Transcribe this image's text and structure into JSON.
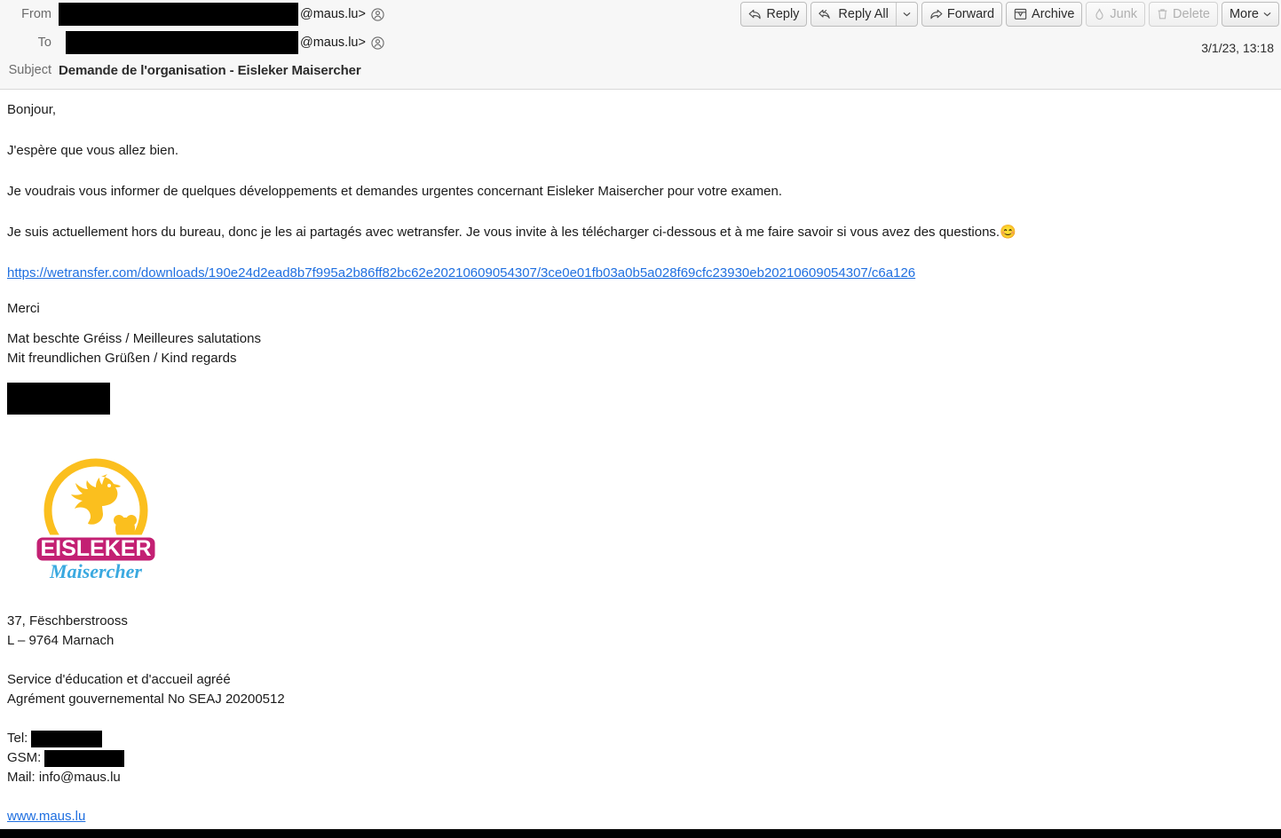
{
  "header": {
    "from_label": "From",
    "to_label": "To",
    "subject_label": "Subject",
    "from_domain": "@maus.lu>",
    "to_domain": "@maus.lu>",
    "subject": "Demande de l'organisation - Eisleker Maisercher",
    "date": "3/1/23, 13:18"
  },
  "toolbar": {
    "reply": "Reply",
    "reply_all": "Reply All",
    "forward": "Forward",
    "archive": "Archive",
    "junk": "Junk",
    "delete": "Delete",
    "more": "More",
    "icons": {
      "reply": "reply-arrow-icon",
      "reply_all": "reply-all-arrow-icon",
      "forward": "forward-arrow-icon",
      "archive": "archive-box-icon",
      "junk": "flame-icon",
      "delete": "trash-icon",
      "dropdown": "chevron-down-icon"
    }
  },
  "body": {
    "greeting": "Bonjour,",
    "line_hope": "J'espère que vous allez bien.",
    "line_inform": "Je voudrais vous informer de quelques développements et demandes urgentes concernant Eisleker Maisercher pour votre examen.",
    "line_wetransfer": "Je suis actuellement hors du bureau, donc je les ai partagés avec wetransfer. Je vous invite à les télécharger ci-dessous et à me faire savoir si vous avez des questions.",
    "emoji": "😊",
    "download_link": "https://wetransfer.com/downloads/190e24d2ead8b7f995a2b86ff82bc62e20210609054307/3ce0e01fb03a0b5a028f69cfc23930eb20210609054307/c6a126",
    "thanks": "Merci",
    "signoff_1": "Mat beschte Gréiss / Meilleures salutations",
    "signoff_2": "Mit freundlichen Grüßen / Kind regards"
  },
  "signature": {
    "logo_alt": "Eisleker Maisercher logo",
    "logo_text_top": "EISLEKER",
    "logo_text_bottom": "Maisercher",
    "address_1": "37, Fëschberstrooss",
    "address_2": "L – 9764 Marnach",
    "service_1": "Service d'éducation et d'accueil agréé",
    "service_2": "Agrément gouvernemental No SEAJ 20200512",
    "tel_label": "Tel:",
    "gsm_label": "GSM:",
    "mail_line": "Mail: info@maus.lu",
    "website": "www.maus.lu"
  },
  "colors": {
    "link": "#1f6fe0",
    "logo_yellow": "#fbbf1e",
    "logo_magenta": "#c32073",
    "logo_blue": "#3aa9e0",
    "header_bg": "#f7f7f7"
  }
}
